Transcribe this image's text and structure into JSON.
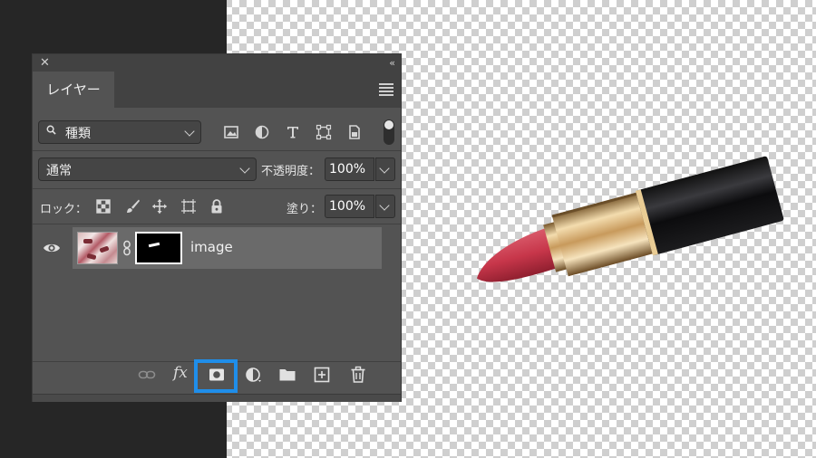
{
  "panel": {
    "tab_label": "レイヤー",
    "filter_label": "種類",
    "blend_mode": "通常",
    "opacity_label": "不透明度：",
    "opacity_value": "100%",
    "lock_label": "ロック：",
    "fill_label": "塗り：",
    "fill_value": "100%"
  },
  "layers": [
    {
      "name": "image",
      "visible": true,
      "has_mask": true
    }
  ],
  "filter_icons": [
    "image-filter-icon",
    "adjustment-filter-icon",
    "type-filter-icon",
    "shape-filter-icon",
    "smart-object-filter-icon"
  ],
  "lock_icons": [
    "lock-transparent-pixels-icon",
    "lock-image-pixels-icon",
    "lock-position-icon",
    "lock-artboard-icon",
    "lock-all-icon"
  ],
  "bottom_icons": [
    "link-layers-icon",
    "fx-icon",
    "add-mask-icon",
    "adjustment-layer-icon",
    "group-folder-icon",
    "new-layer-icon",
    "trash-icon"
  ],
  "highlight_color": "#1f8eea"
}
